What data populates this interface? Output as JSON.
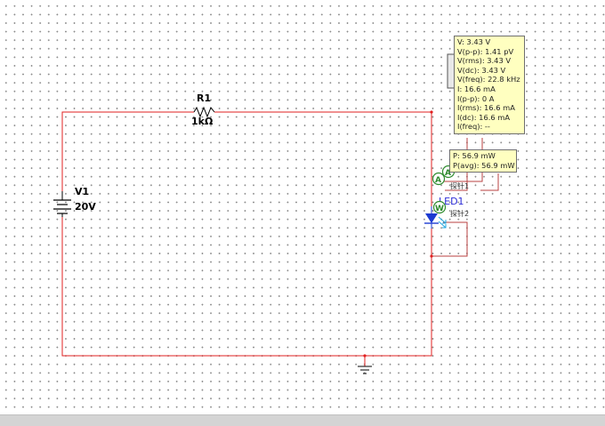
{
  "components": {
    "resistor": {
      "ref": "R1",
      "value": "1kΩ"
    },
    "source": {
      "ref": "V1",
      "value": "20V"
    },
    "led": {
      "ref": "LED1"
    }
  },
  "probe1": {
    "readings": [
      "V: 3.43 V",
      "V(p-p): 1.41 pV",
      "V(rms): 3.43 V",
      "V(dc): 3.43 V",
      "V(freq): 22.8 kHz",
      "I: 16.6 mA",
      "I(p-p): 0 A",
      "I(rms): 16.6 mA",
      "I(dc): 16.6 mA",
      "I(freq): --"
    ],
    "tag": "探针1"
  },
  "probe2": {
    "readings": [
      "P: 56.9 mW",
      "P(avg): 56.9 mW"
    ],
    "tag": "探针2"
  },
  "meters": {
    "ammeter_symbol": "A",
    "wattmeter_symbol": "W"
  },
  "colors": {
    "wire": "#e02020",
    "probe_wire": "#b94040",
    "led": "#1d3bd1",
    "led_label": "#2b2bd6",
    "probe_bg": "#ffffc0",
    "meter": "#2e8b2e"
  }
}
